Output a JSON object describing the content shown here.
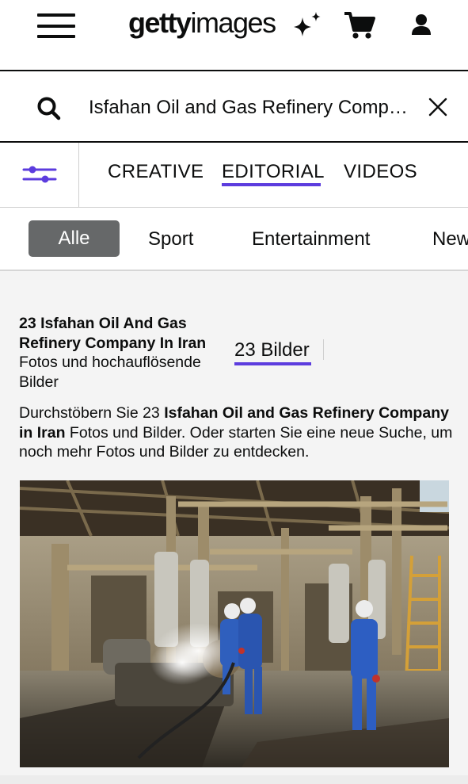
{
  "header": {
    "logo_bold": "getty",
    "logo_light": "images",
    "icons": [
      "menu-icon",
      "sparkle-icon",
      "cart-icon",
      "user-icon"
    ]
  },
  "search": {
    "query": "Isfahan Oil and Gas Refinery Compan…",
    "placeholder": "Isfahan Oil and Gas Refinery Company in Iran"
  },
  "asset_tabs": [
    {
      "label": "CREATIVE",
      "active": false
    },
    {
      "label": "EDITORIAL",
      "active": true
    },
    {
      "label": "VIDEOS",
      "active": false
    }
  ],
  "categories": [
    {
      "label": "Alle",
      "active": true
    },
    {
      "label": "Sport",
      "active": false
    },
    {
      "label": "Entertainment",
      "active": false
    },
    {
      "label": "New",
      "active": false
    }
  ],
  "results": {
    "heading_bold": "23 Isfahan Oil And Gas Refinery Company In Iran",
    "heading_regular": "Fotos und hochauflösende Bilder",
    "count_label": "23 Bilder",
    "description": {
      "part1": "Durchstöbern Sie 23 ",
      "bold": "Isfahan Oil and Gas Refinery Company in Iran",
      "part2": " Fotos und Bilder. Oder starten Sie eine neue Suche, um noch mehr Fotos und Bilder zu entdecken."
    }
  },
  "colors": {
    "accent": "#5c3cde",
    "active_pill": "#666869",
    "text": "#0c0d0d",
    "background": "#f4f4f4"
  }
}
